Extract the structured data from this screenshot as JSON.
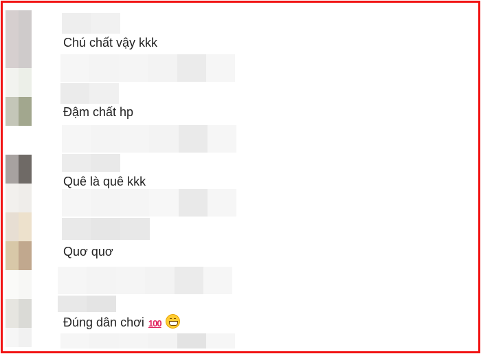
{
  "comments": [
    {
      "text": "Chú chất vậy kkk"
    },
    {
      "text": "Đậm chất hp"
    },
    {
      "text": "Quê là quê kkk"
    },
    {
      "text": "Quơ quơ"
    },
    {
      "text": "Đúng dân chơi",
      "emoji_hundred": "100",
      "emoji_grin": "grinning-face-icon"
    }
  ],
  "colors": {
    "frame": "#f11212",
    "text": "#222222",
    "blur_light": "#f5f5f5",
    "blur_mid": "#ebebeb"
  }
}
